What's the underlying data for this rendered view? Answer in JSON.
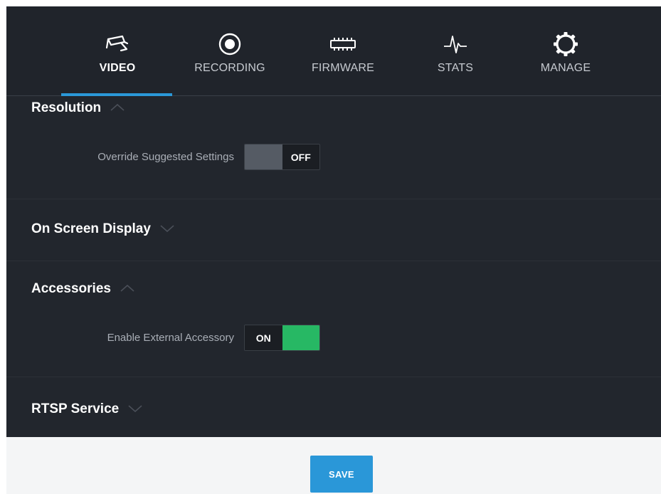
{
  "tabs": [
    {
      "label": "VIDEO",
      "icon": "camera-icon",
      "active": true
    },
    {
      "label": "RECORDING",
      "icon": "record-icon",
      "active": false
    },
    {
      "label": "FIRMWARE",
      "icon": "chip-icon",
      "active": false
    },
    {
      "label": "STATS",
      "icon": "pulse-icon",
      "active": false
    },
    {
      "label": "MANAGE",
      "icon": "gear-icon",
      "active": false
    }
  ],
  "sections": {
    "resolution": {
      "title": "Resolution",
      "expanded": true,
      "setting_label": "Override Suggested Settings",
      "toggle_state": "OFF"
    },
    "osd": {
      "title": "On Screen Display",
      "expanded": false
    },
    "accessories": {
      "title": "Accessories",
      "expanded": true,
      "setting_label": "Enable External Accessory",
      "toggle_state": "ON"
    },
    "rtsp": {
      "title": "RTSP Service",
      "expanded": false
    }
  },
  "footer": {
    "save_label": "SAVE"
  },
  "colors": {
    "background": "#22262d",
    "accent": "#2a97d8",
    "toggle_on": "#27b864",
    "toggle_off": "#555b64",
    "footer_bg": "#f4f5f6"
  }
}
